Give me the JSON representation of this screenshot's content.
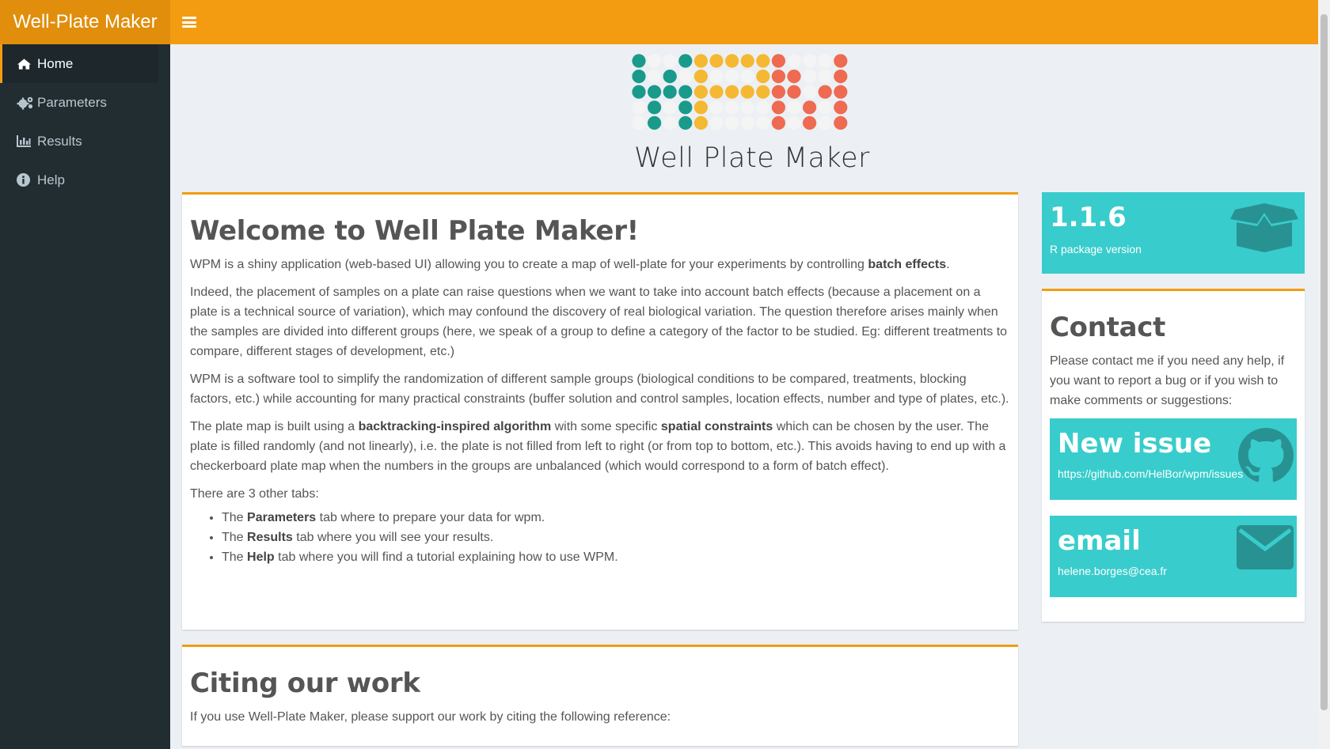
{
  "header": {
    "brand": "Well-Plate Maker"
  },
  "sidebar": {
    "items": [
      {
        "label": "Home",
        "icon": "home-icon"
      },
      {
        "label": "Parameters",
        "icon": "gears-icon"
      },
      {
        "label": "Results",
        "icon": "bar-chart-icon"
      },
      {
        "label": "Help",
        "icon": "info-circle-icon"
      }
    ]
  },
  "logo": {
    "text": "Well Plate Maker",
    "colors": {
      "teal": "#1a9a8a",
      "yellow": "#f5b833",
      "red": "#ee6a50",
      "empty": "#f4f4f4"
    }
  },
  "welcome": {
    "title": "Welcome to Well Plate Maker!",
    "p1_a": "WPM is a shiny application (web-based UI) allowing you to create a map of well-plate for your experiments by controlling ",
    "p1_b": "batch effects",
    "p1_c": ".",
    "p2": "Indeed, the placement of samples on a plate can raise questions when we want to take into account batch effects (because a placement on a plate is a technical source of variation), which may confound the discovery of real biological variation. The question therefore arises mainly when the samples are divided into different groups (here, we speak of a group to define a category of the factor to be studied. Eg: different treatments to compare, different stages of development, etc.)",
    "p3": "WPM is a software tool to simplify the randomization of different sample groups (biological conditions to be compared, treatments, blocking factors, etc.) while accounting for many practical constraints (buffer solution and control samples, location effects, number and type of plates, etc.).",
    "p4_a": "The plate map is built using a ",
    "p4_b": "backtracking-inspired algorithm",
    "p4_c": " with some specific ",
    "p4_d": "spatial constraints",
    "p4_e": " which can be chosen by the user. The plate is filled randomly (and not linearly), i.e. the plate is not filled from left to right (or from top to bottom, etc.). This avoids having to end up with a checkerboard plate map when the numbers in the groups are unbalanced (which would correspond to a form of batch effect).",
    "p5": "There are 3 other tabs:",
    "tabs": [
      {
        "pre": "The ",
        "bold": "Parameters",
        "post": " tab where to prepare your data for wpm."
      },
      {
        "pre": "The ",
        "bold": "Results",
        "post": " tab where you will see your results."
      },
      {
        "pre": "The ",
        "bold": "Help",
        "post": " tab where you will find a tutorial explaining how to use WPM."
      }
    ]
  },
  "cite": {
    "title": "Citing our work",
    "text": "If you use Well-Plate Maker, please support our work by citing the following reference:"
  },
  "version": {
    "value": "1.1.6",
    "label": "R package version",
    "icon": "package-icon"
  },
  "contact": {
    "title": "Contact",
    "text": "Please contact me if you need any help, if you want to report a bug or if you wish to make comments or suggestions:",
    "issue": {
      "title": "New issue",
      "link": "https://github.com/HelBor/wpm/issues",
      "icon": "github-icon"
    },
    "email": {
      "title": "email",
      "address": "helene.borges@cea.fr",
      "icon": "envelope-icon"
    }
  },
  "colors": {
    "header": "#f39c12",
    "brand": "#e08e0b",
    "sidebar": "#222d32",
    "box_accent": "#f39c12",
    "info_box": "#39cccc"
  }
}
